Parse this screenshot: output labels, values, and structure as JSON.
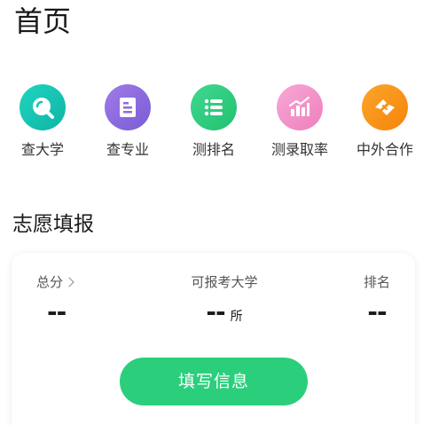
{
  "header": {
    "title": "首页"
  },
  "quick_nav": {
    "items": [
      {
        "label": "查大学",
        "icon": "search-icon",
        "color": "#14c4b0"
      },
      {
        "label": "查专业",
        "icon": "document-icon",
        "color": "#8e6cdc"
      },
      {
        "label": "测排名",
        "icon": "list-icon",
        "color": "#2fcc82"
      },
      {
        "label": "测录取率",
        "icon": "bar-chart-icon",
        "color": "#f48fc8"
      },
      {
        "label": "中外合作",
        "icon": "handshake-icon",
        "color": "#f8940f"
      }
    ]
  },
  "volunteer": {
    "section_title": "志愿填报",
    "total_score": {
      "label": "总分",
      "value": "--"
    },
    "universities": {
      "label": "可报考大学",
      "value": "--",
      "unit": "所"
    },
    "ranking": {
      "label": "排名",
      "value": "--"
    },
    "fill_button_label": "填写信息",
    "accent_color": "#2bcf7b"
  }
}
